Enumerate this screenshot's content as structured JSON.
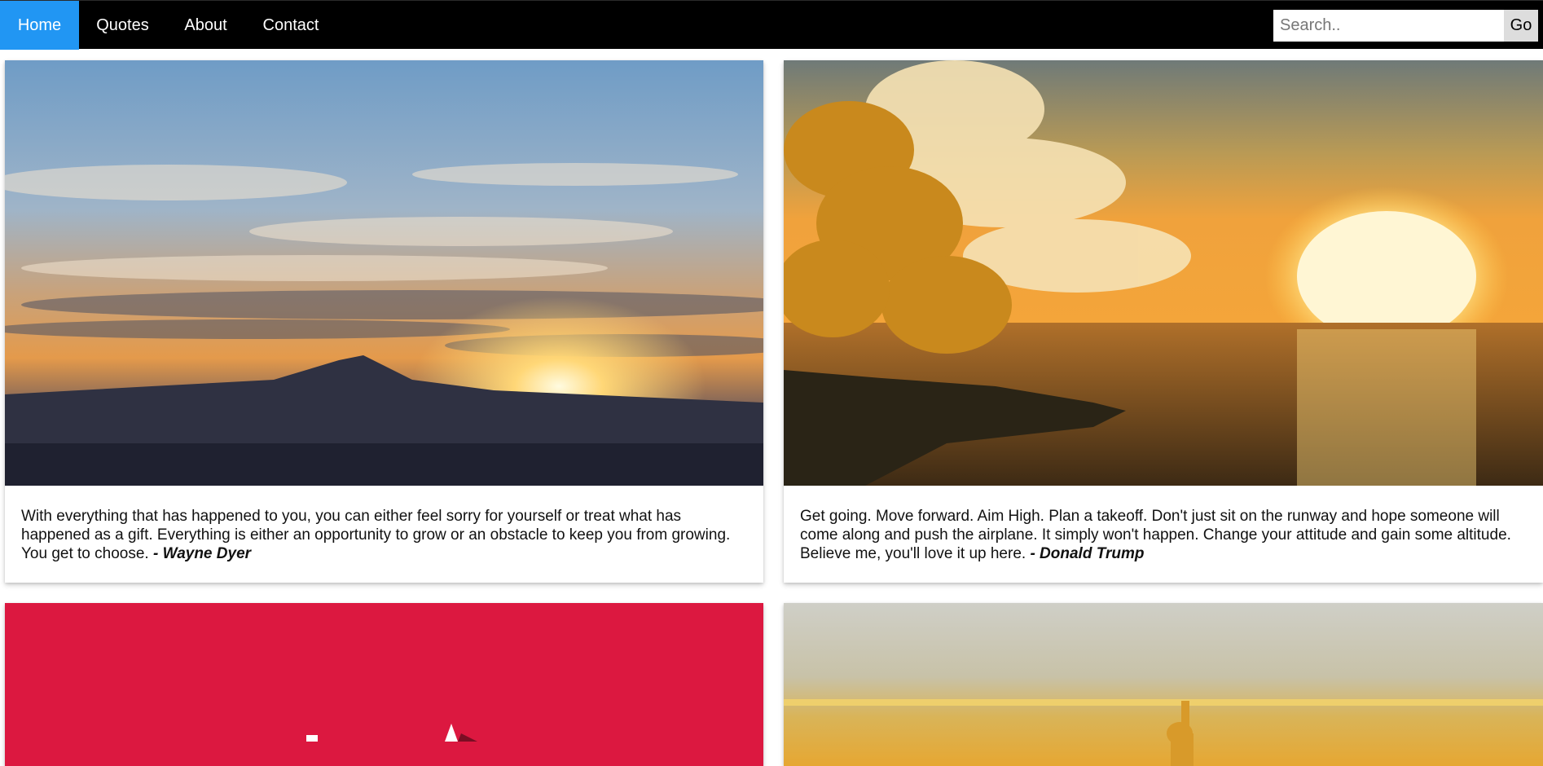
{
  "nav": {
    "items": [
      {
        "label": "Home",
        "active": true
      },
      {
        "label": "Quotes",
        "active": false
      },
      {
        "label": "About",
        "active": false
      },
      {
        "label": "Contact",
        "active": false
      }
    ],
    "search_placeholder": "Search..",
    "go_label": "Go",
    "active_color": "#2196F3",
    "bar_color": "#000000"
  },
  "cards": [
    {
      "image": "mountain-sunset-image",
      "quote": "With everything that has happened to you, you can either feel sorry for yourself or treat what has happened as a gift. Everything is either an opportunity to grow or an obstacle to keep you from growing. You get to choose.",
      "author": "- Wayne Dyer"
    },
    {
      "image": "sea-sunset-tree-image",
      "quote": "Get going. Move forward. Aim High. Plan a takeoff. Don't just sit on the runway and hope someone will come along and push the airplane. It simply won't happen. Change your attitude and gain some altitude. Believe me, you'll love it up here.",
      "author": "- Donald Trump"
    },
    {
      "image": "red-background-image",
      "background_color": "#DC1840"
    },
    {
      "image": "golden-sunrise-figure-image"
    }
  ]
}
